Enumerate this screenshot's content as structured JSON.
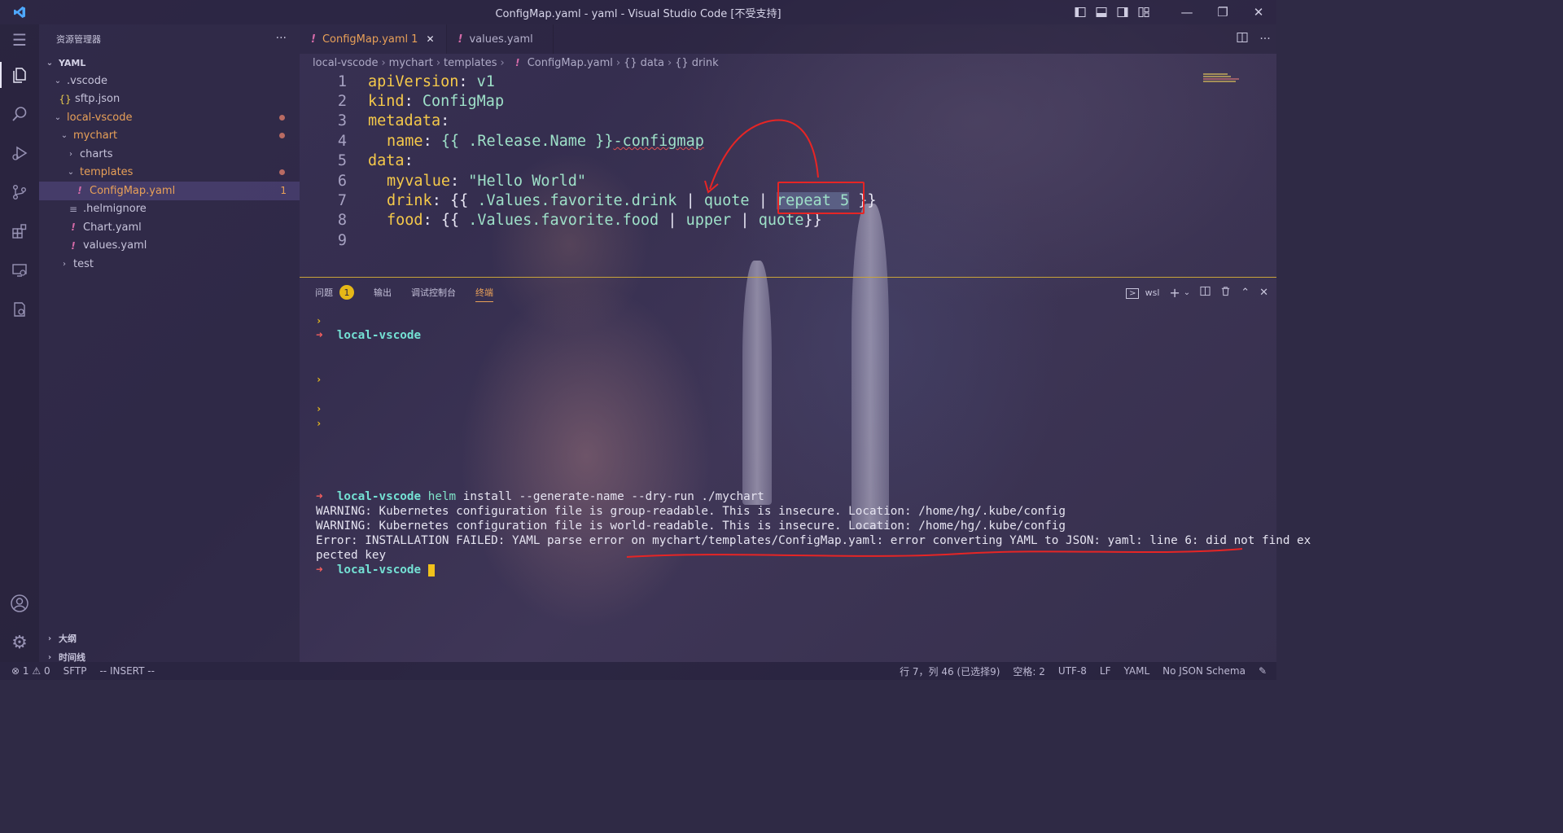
{
  "window": {
    "title": "ConfigMap.yaml - yaml - Visual Studio Code [不受支持]"
  },
  "explorer": {
    "title": "资源管理器",
    "root": "YAML",
    "items": [
      {
        "label": ".vscode"
      },
      {
        "label": "sftp.json"
      },
      {
        "label": "local-vscode"
      },
      {
        "label": "mychart"
      },
      {
        "label": "charts"
      },
      {
        "label": "templates"
      },
      {
        "label": "ConfigMap.yaml",
        "problems": "1"
      },
      {
        "label": ".helmignore"
      },
      {
        "label": "Chart.yaml"
      },
      {
        "label": "values.yaml"
      },
      {
        "label": "test"
      }
    ],
    "outline": "大纲",
    "timeline": "时间线"
  },
  "tabs": [
    {
      "label": "ConfigMap.yaml",
      "problems": "1"
    },
    {
      "label": "values.yaml"
    }
  ],
  "breadcrumb": [
    "local-vscode",
    "mychart",
    "templates",
    "ConfigMap.yaml",
    "data",
    "drink"
  ],
  "code": {
    "line_numbers": [
      "1",
      "2",
      "3",
      "4",
      "5",
      "6",
      "7",
      "8",
      "9"
    ],
    "l1": {
      "key": "apiVersion",
      "val": " v1"
    },
    "l2": {
      "key": "kind",
      "val": " ConfigMap"
    },
    "l3": {
      "key": "metadata"
    },
    "l4": {
      "key": "name",
      "tmpl": " {{ .Release.Name }}",
      "rest": "-configmap"
    },
    "l5": {
      "key": "data"
    },
    "l6": {
      "key": "myvalue",
      "val": " \"Hello World\""
    },
    "l7": {
      "key": "drink",
      "open": " {{",
      "expr": " .Values.favorite.drink",
      "pipe1": " | ",
      "f1": "quote",
      "pipe2": " | ",
      "f2": "repeat 5",
      "close": " }}"
    },
    "l8": {
      "key": "food",
      "open": " {{",
      "expr": " .Values.favorite.food",
      "pipe1": " | ",
      "f1": "upper",
      "pipe2": " | ",
      "f2": "quote",
      "close": "}}"
    }
  },
  "panel": {
    "tabs": [
      "问题",
      "输出",
      "调试控制台",
      "终端"
    ],
    "problems_badge": "1",
    "terminal_profile": "wsl"
  },
  "terminal": {
    "prompt_cwd": "local-vscode",
    "command_name": "helm",
    "command_args": " install --generate-name --dry-run ./mychart",
    "warning1": "WARNING: Kubernetes configuration file is group-readable. This is insecure. Location: /home/hg/.kube/config",
    "warning2": "WARNING: Kubernetes configuration file is world-readable. This is insecure. Location: /home/hg/.kube/config",
    "error1": "Error: INSTALLATION FAILED: YAML parse error on mychart/templates/ConfigMap.yaml: error converting YAML to JSON: yaml: line 6: did not find ex",
    "error2": "pected key"
  },
  "statusbar": {
    "errors": "1",
    "warnings": "0",
    "sftp": "SFTP",
    "mode": "-- INSERT --",
    "position": "行 7，列 46 (已选择9)",
    "spaces": "空格: 2",
    "encoding": "UTF-8",
    "eol": "LF",
    "language": "YAML",
    "schema": "No JSON Schema"
  },
  "colors": {
    "accent": "#e8a058",
    "yaml_key": "#f5c94a",
    "string": "#9ee0c8",
    "annotation": "#e62525"
  }
}
